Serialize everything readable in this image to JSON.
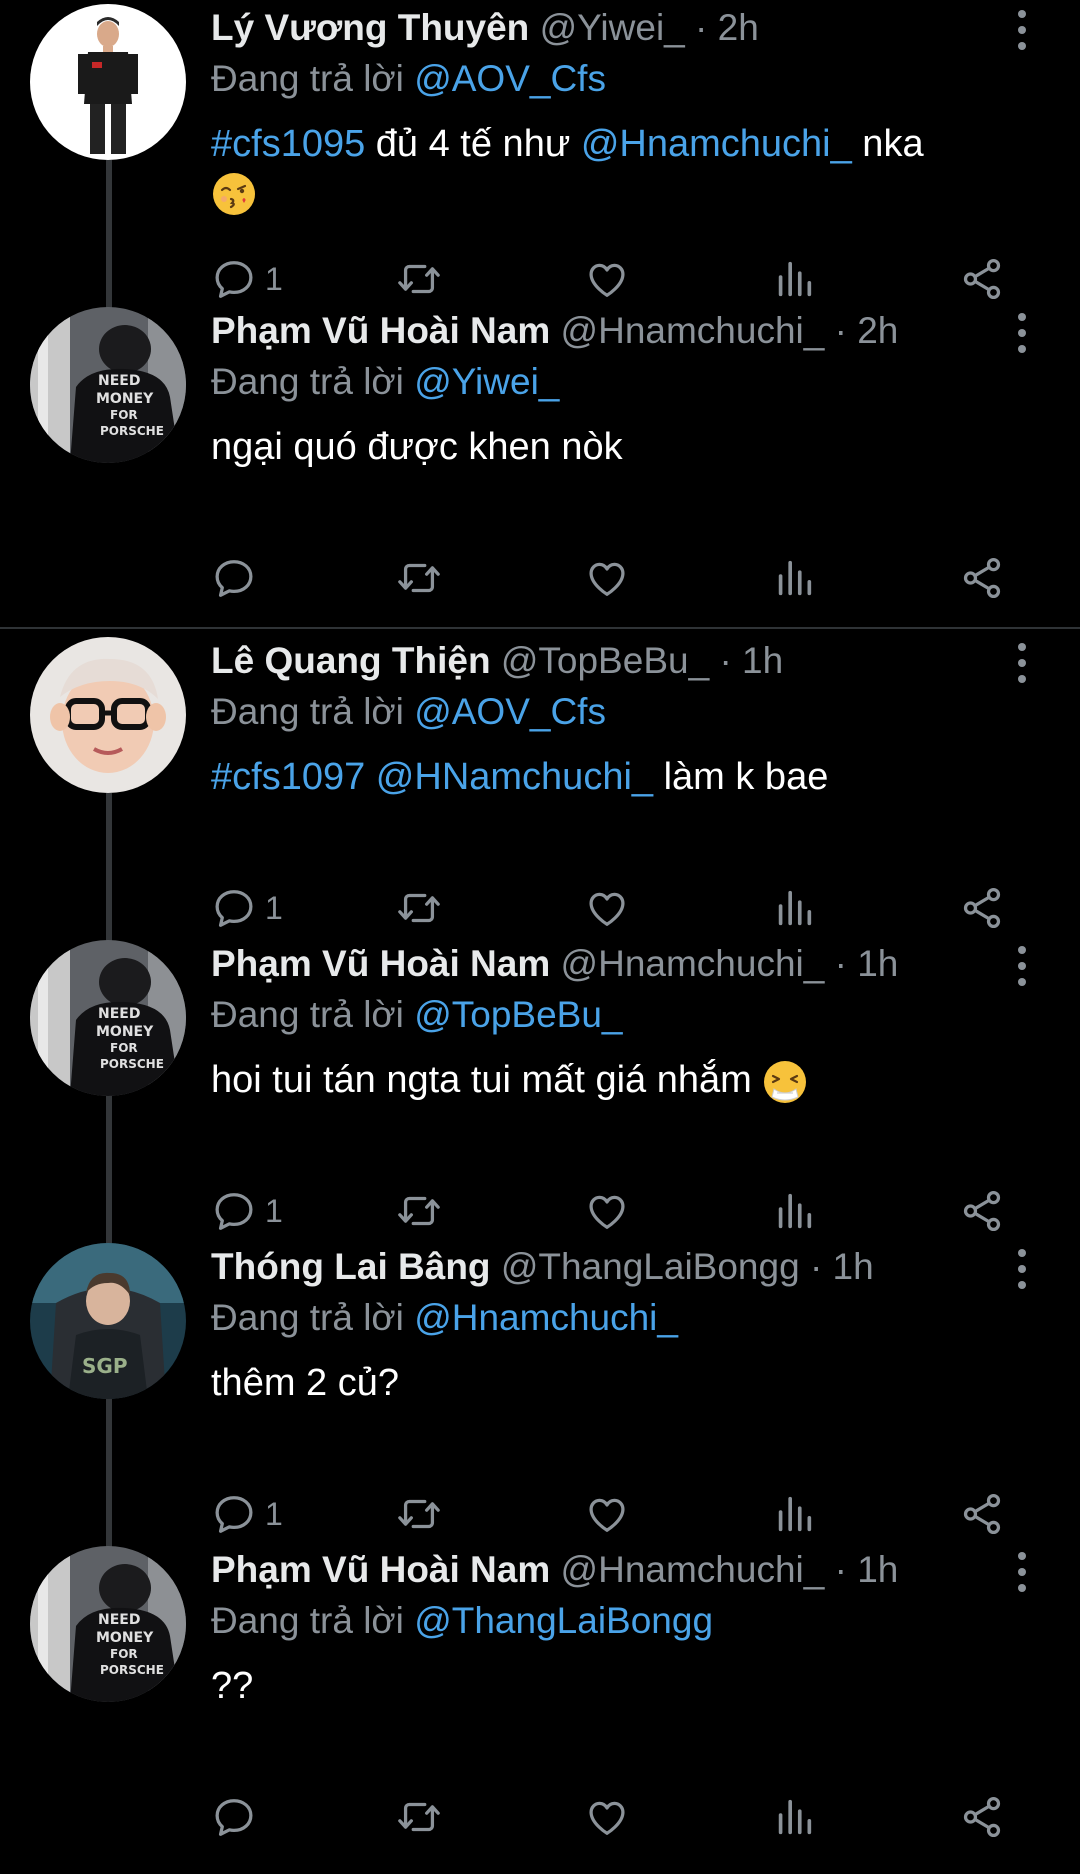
{
  "colors": {
    "background": "#000000",
    "link": "#4aa3e8",
    "muted": "#8b9299",
    "text": "#e7e9ea"
  },
  "tweets": [
    {
      "name": "Lý Vương Thuyên",
      "handle": "@Yiwei_",
      "dot": "·",
      "time": "2h",
      "reply_prefix": "Đang trả lời",
      "reply_to": "@AOV_Cfs",
      "body": [
        {
          "type": "link",
          "text": "#cfs1095"
        },
        {
          "type": "text",
          "text": " đủ 4 tế như "
        },
        {
          "type": "link",
          "text": "@Hnamchuchi_"
        },
        {
          "type": "text",
          "text": " nka"
        }
      ],
      "emoji": "kissing-face-emoji",
      "reply_count": "1",
      "avatar": "player-avatar"
    },
    {
      "name": "Phạm Vũ Hoài Nam",
      "handle": "@Hnamchuchi_",
      "dot": "·",
      "time": "2h",
      "reply_prefix": "Đang trả lời",
      "reply_to": "@Yiwei_",
      "body": [
        {
          "type": "text",
          "text": "ngại quó được khen nòk"
        }
      ],
      "reply_count": "",
      "avatar": "need-money-avatar"
    },
    {
      "name": "Lê Quang Thiện",
      "handle": "@TopBeBu_",
      "dot": "·",
      "time": "1h",
      "reply_prefix": "Đang trả lời",
      "reply_to": "@AOV_Cfs",
      "body": [
        {
          "type": "link",
          "text": "#cfs1097"
        },
        {
          "type": "text",
          "text": " "
        },
        {
          "type": "link",
          "text": "@HNamchuchi_"
        },
        {
          "type": "text",
          "text": " làm k bae"
        }
      ],
      "reply_count": "1",
      "avatar": "glasses-avatar"
    },
    {
      "name": "Phạm Vũ Hoài Nam",
      "handle": "@Hnamchuchi_",
      "dot": "·",
      "time": "1h",
      "reply_prefix": "Đang trả lời",
      "reply_to": "@TopBeBu_",
      "body": [
        {
          "type": "text",
          "text": "hoi tui tán ngta tui mất giá nhắm"
        }
      ],
      "emoji": "sneezing-face-emoji",
      "reply_count": "1",
      "avatar": "need-money-avatar"
    },
    {
      "name": "Thóng Lai Bâng",
      "handle": "@ThangLaiBongg",
      "dot": "·",
      "time": "1h",
      "reply_prefix": "Đang trả lời",
      "reply_to": "@Hnamchuchi_",
      "body": [
        {
          "type": "text",
          "text": "thêm 2 củ?"
        }
      ],
      "reply_count": "1",
      "avatar": "gamer-avatar"
    },
    {
      "name": "Phạm Vũ Hoài Nam",
      "handle": "@Hnamchuchi_",
      "dot": "·",
      "time": "1h",
      "reply_prefix": "Đang trả lời",
      "reply_to": "@ThangLaiBongg",
      "body": [
        {
          "type": "text",
          "text": "??"
        }
      ],
      "reply_count": "",
      "avatar": "need-money-avatar"
    }
  ]
}
